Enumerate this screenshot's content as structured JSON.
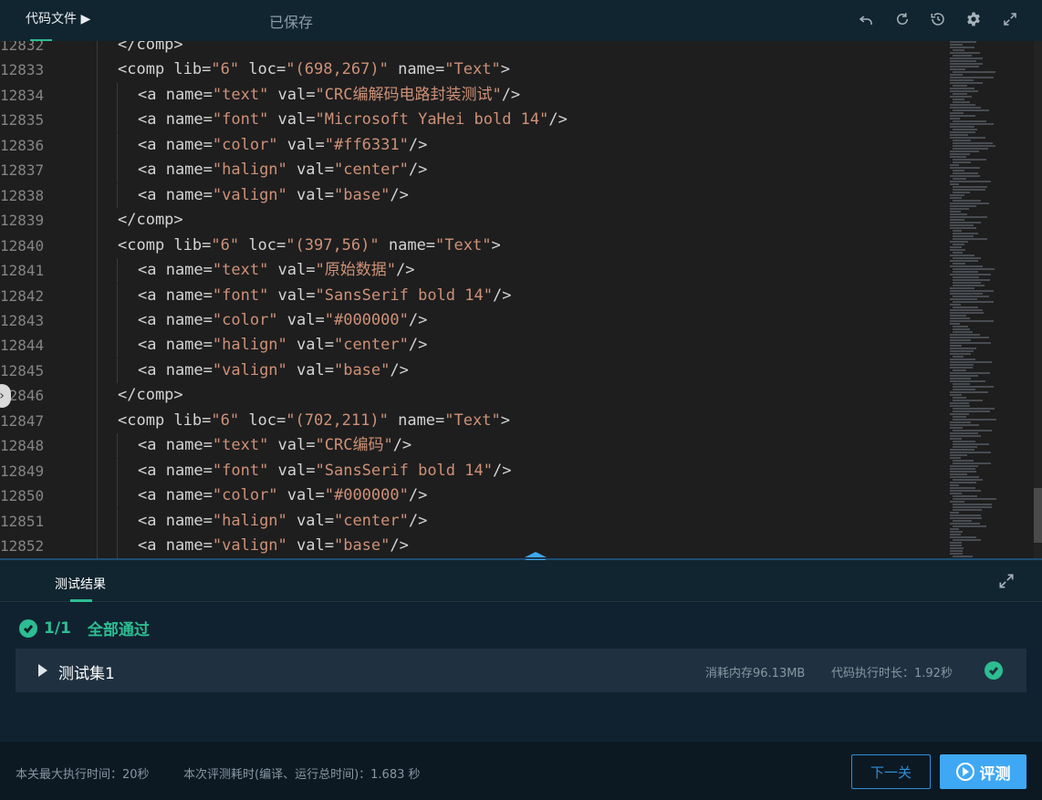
{
  "topbar": {
    "tab_label": "代码文件 ▶",
    "saved_status": "已保存",
    "icons": [
      "undo-icon",
      "refresh-icon",
      "history-icon",
      "settings-icon",
      "expand-icon"
    ]
  },
  "editor": {
    "lines": [
      {
        "num": "12832",
        "indent": 0,
        "text": "</comp>"
      },
      {
        "num": "12833",
        "indent": 0,
        "text": "<comp lib=\"6\" loc=\"(698,267)\" name=\"Text\">"
      },
      {
        "num": "12834",
        "indent": 1,
        "text": "<a name=\"text\" val=\"CRC编解码电路封装测试\"/>"
      },
      {
        "num": "12835",
        "indent": 1,
        "text": "<a name=\"font\" val=\"Microsoft YaHei bold 14\"/>"
      },
      {
        "num": "12836",
        "indent": 1,
        "text": "<a name=\"color\" val=\"#ff6331\"/>"
      },
      {
        "num": "12837",
        "indent": 1,
        "text": "<a name=\"halign\" val=\"center\"/>"
      },
      {
        "num": "12838",
        "indent": 1,
        "text": "<a name=\"valign\" val=\"base\"/>"
      },
      {
        "num": "12839",
        "indent": 0,
        "text": "</comp>"
      },
      {
        "num": "12840",
        "indent": 0,
        "text": "<comp lib=\"6\" loc=\"(397,56)\" name=\"Text\">"
      },
      {
        "num": "12841",
        "indent": 1,
        "text": "<a name=\"text\" val=\"原始数据\"/>"
      },
      {
        "num": "12842",
        "indent": 1,
        "text": "<a name=\"font\" val=\"SansSerif bold 14\"/>"
      },
      {
        "num": "12843",
        "indent": 1,
        "text": "<a name=\"color\" val=\"#000000\"/>"
      },
      {
        "num": "12844",
        "indent": 1,
        "text": "<a name=\"halign\" val=\"center\"/>"
      },
      {
        "num": "12845",
        "indent": 1,
        "text": "<a name=\"valign\" val=\"base\"/>"
      },
      {
        "num": "12846",
        "indent": 0,
        "text": "</comp>"
      },
      {
        "num": "12847",
        "indent": 0,
        "text": "<comp lib=\"6\" loc=\"(702,211)\" name=\"Text\">"
      },
      {
        "num": "12848",
        "indent": 1,
        "text": "<a name=\"text\" val=\"CRC编码\"/>"
      },
      {
        "num": "12849",
        "indent": 1,
        "text": "<a name=\"font\" val=\"SansSerif bold 14\"/>"
      },
      {
        "num": "12850",
        "indent": 1,
        "text": "<a name=\"color\" val=\"#000000\"/>"
      },
      {
        "num": "12851",
        "indent": 1,
        "text": "<a name=\"halign\" val=\"center\"/>"
      },
      {
        "num": "12852",
        "indent": 1,
        "text": "<a name=\"valign\" val=\"base\"/>"
      }
    ]
  },
  "results": {
    "tab_label": "测试结果",
    "summary_count": "1/1",
    "summary_text": "全部通过",
    "testset": {
      "name": "测试集1",
      "memory": "消耗内存96.13MB",
      "exec_time": "代码执行时长：1.92秒"
    }
  },
  "footer": {
    "max_time": "本关最大执行时间：20秒",
    "run_time": "本次评测耗时(编译、运行总时间)：1.683 秒",
    "next_label": "下一关",
    "eval_label": "评测"
  },
  "colors": {
    "accent_green": "#2dbd92",
    "accent_blue": "#3fa8f4",
    "string": "#ce9178",
    "editor_bg": "#1e1e1e"
  }
}
